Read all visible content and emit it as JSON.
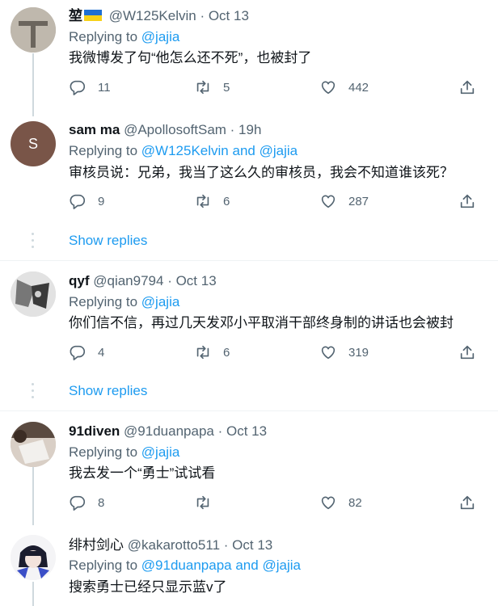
{
  "labels": {
    "replying_to": "Replying to",
    "and": "and",
    "show_replies": "Show replies"
  },
  "tweets": [
    {
      "display_name": "堃",
      "has_flag": true,
      "handle": "@W125Kelvin",
      "time": "· Oct 13",
      "reply_to_1": "@jajia",
      "text": "我微博发了句“他怎么还不死”，也被封了",
      "replies": "11",
      "retweets": "5",
      "likes": "442"
    },
    {
      "display_name": "sam ma",
      "avatar_letter": "S",
      "handle": "@ApollosoftSam",
      "time": "· 19h",
      "reply_to_1": "@W125Kelvin",
      "reply_to_2": "@jajia",
      "text": "审核员说：兄弟，我当了这么久的审核员，我会不知道谁该死？",
      "replies": "9",
      "retweets": "6",
      "likes": "287"
    },
    {
      "display_name": "qyf",
      "handle": "@qian9794",
      "time": "· Oct 13",
      "reply_to_1": "@jajia",
      "text": "你们信不信，再过几天发邓小平取消干部终身制的讲话也会被封",
      "replies": "4",
      "retweets": "6",
      "likes": "319"
    },
    {
      "display_name": "91diven",
      "handle": "@91duanpapa",
      "time": "· Oct 13",
      "reply_to_1": "@jajia",
      "text": "我去发一个“勇士”试试看",
      "replies": "8",
      "retweets": "",
      "likes": "82"
    },
    {
      "display_name": "绯村剑心",
      "handle": "@kakarotto511",
      "time": "· Oct 13",
      "reply_to_1": "@91duanpapa",
      "reply_to_2": "@jajia",
      "text": "搜索勇士已经只显示蓝v了"
    }
  ],
  "colors": {
    "link": "#1d9bf0",
    "muted": "#536471",
    "text": "#0f1419",
    "sam_avatar": "#795548"
  },
  "icons": [
    "reply-icon",
    "retweet-icon",
    "like-icon",
    "share-icon"
  ]
}
